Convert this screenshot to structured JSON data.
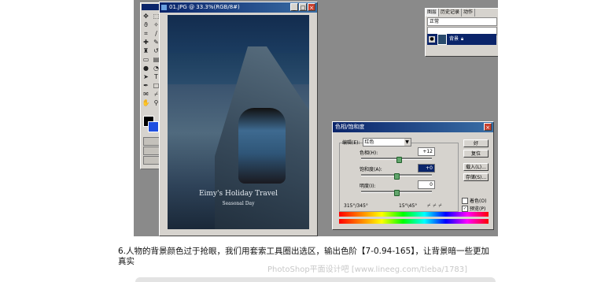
{
  "document_window": {
    "title": "01.JPG @ 33.3%(RGB/8#)",
    "photo_caption_line1": "Eimy's Holiday Travel",
    "photo_caption_line2": "Seasonal Day"
  },
  "panel": {
    "tabs": [
      "图层",
      "历史记录",
      "动作"
    ],
    "blend_mode": "正常",
    "layer_name": "背景"
  },
  "dialog": {
    "title": "色相/饱和度",
    "edit_label": "编辑(E):",
    "edit_value": "红色",
    "hue_label": "色相(H):",
    "hue_value": "+12",
    "saturation_label": "饱和度(A):",
    "saturation_value": "+0",
    "lightness_label": "明度(I):",
    "lightness_value": "0",
    "sliders": {
      "hue": 12,
      "saturation": 0,
      "lightness": 0
    },
    "range_left": "315°/345°",
    "range_right": "15°\\45°",
    "buttons": [
      "好",
      "复位",
      "载入(L)...",
      "存储(S)..."
    ],
    "colorize_label": "着色(O)",
    "preview_label": "预览(P)",
    "preview_checked": true
  },
  "instruction": {
    "text": "6.人物的背景颜色过于抢眼，我们用套索工具圈出选区，输出色阶【7-0.94-165】，让背景暗一些更加真实"
  },
  "watermark": {
    "text": "PhotoShop平面设计吧 [www.lineeg.com/tieba/1783]"
  },
  "colors": {
    "foreground": "#000000",
    "background": "#1f4fe0",
    "titlebar": "#0a246a"
  }
}
